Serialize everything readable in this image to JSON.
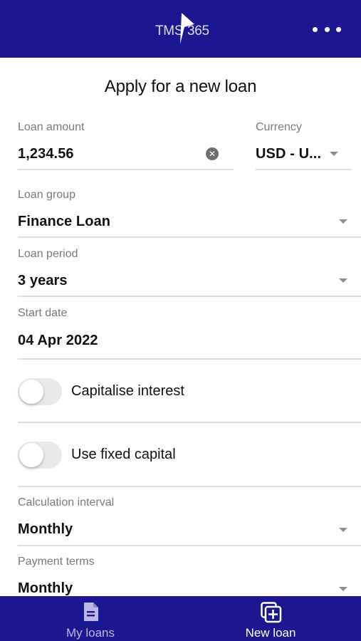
{
  "header": {
    "logo_left": "TMS",
    "logo_right": "365",
    "more_icon": "more-horizontal-icon"
  },
  "page": {
    "title": "Apply for a new loan"
  },
  "form": {
    "loan_amount": {
      "label": "Loan amount",
      "value": "1,234.56"
    },
    "currency": {
      "label": "Currency",
      "value": "USD - U..."
    },
    "loan_group": {
      "label": "Loan group",
      "value": "Finance Loan"
    },
    "loan_period": {
      "label": "Loan period",
      "value": "3 years"
    },
    "start_date": {
      "label": "Start date",
      "value": "04 Apr 2022"
    },
    "capitalise_interest": {
      "label": "Capitalise interest",
      "on": false
    },
    "use_fixed_capital": {
      "label": "Use fixed capital",
      "on": false
    },
    "calculation_interval": {
      "label": "Calculation interval",
      "value": "Monthly"
    },
    "payment_terms": {
      "label": "Payment terms",
      "value": "Monthly"
    }
  },
  "tabbar": {
    "tabs": [
      {
        "label": "My loans",
        "icon": "document-icon",
        "active": false
      },
      {
        "label": "New loan",
        "icon": "add-copy-icon",
        "active": true
      }
    ]
  },
  "colors": {
    "brand": "#1c1690",
    "label": "#7a7a7a",
    "divider": "#dedede"
  }
}
